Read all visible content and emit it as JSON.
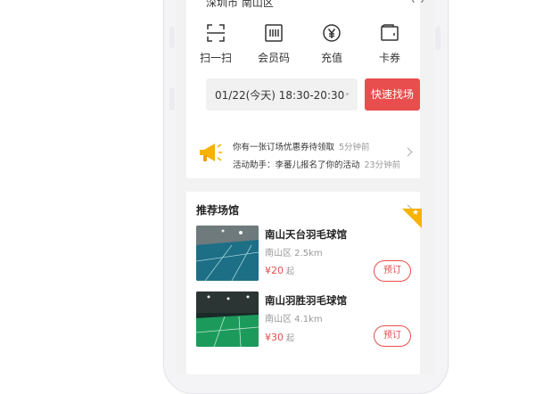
{
  "header": {
    "location": "深圳市 南山区",
    "location_icon": "location-ring-icon"
  },
  "quick_actions": [
    {
      "label": "扫一扫",
      "icon": "scan-icon"
    },
    {
      "label": "会员码",
      "icon": "barcode-icon"
    },
    {
      "label": "充值",
      "icon": "yuan-coin-icon"
    },
    {
      "label": "卡券",
      "icon": "wallet-icon"
    }
  ],
  "booking": {
    "date_time": "01/22(今天) 18:30-20:30",
    "search_label": "快速找场"
  },
  "notices": {
    "icon": "megaphone-icon",
    "items": [
      {
        "text": "你有一张订场优惠券待领取",
        "time": "5分钟前"
      },
      {
        "text": "活动助手：李蕃儿报名了你的活动",
        "time": "23分钟前"
      }
    ]
  },
  "venues": {
    "title": "推荐场馆",
    "items": [
      {
        "name": "南山天台羽毛球馆",
        "district": "南山区 2.5km",
        "price": "¥20",
        "price_unit": "起",
        "book_label": "预订",
        "featured": true
      },
      {
        "name": "南山羽胜羽毛球馆",
        "district": "南山区 4.1km",
        "price": "¥30",
        "price_unit": "起",
        "book_label": "预订",
        "featured": false
      }
    ]
  },
  "colors": {
    "accent": "#e84e4e",
    "badge": "#f6b300",
    "court_blue": "#1d6f86",
    "court_green": "#1c9a5c"
  }
}
